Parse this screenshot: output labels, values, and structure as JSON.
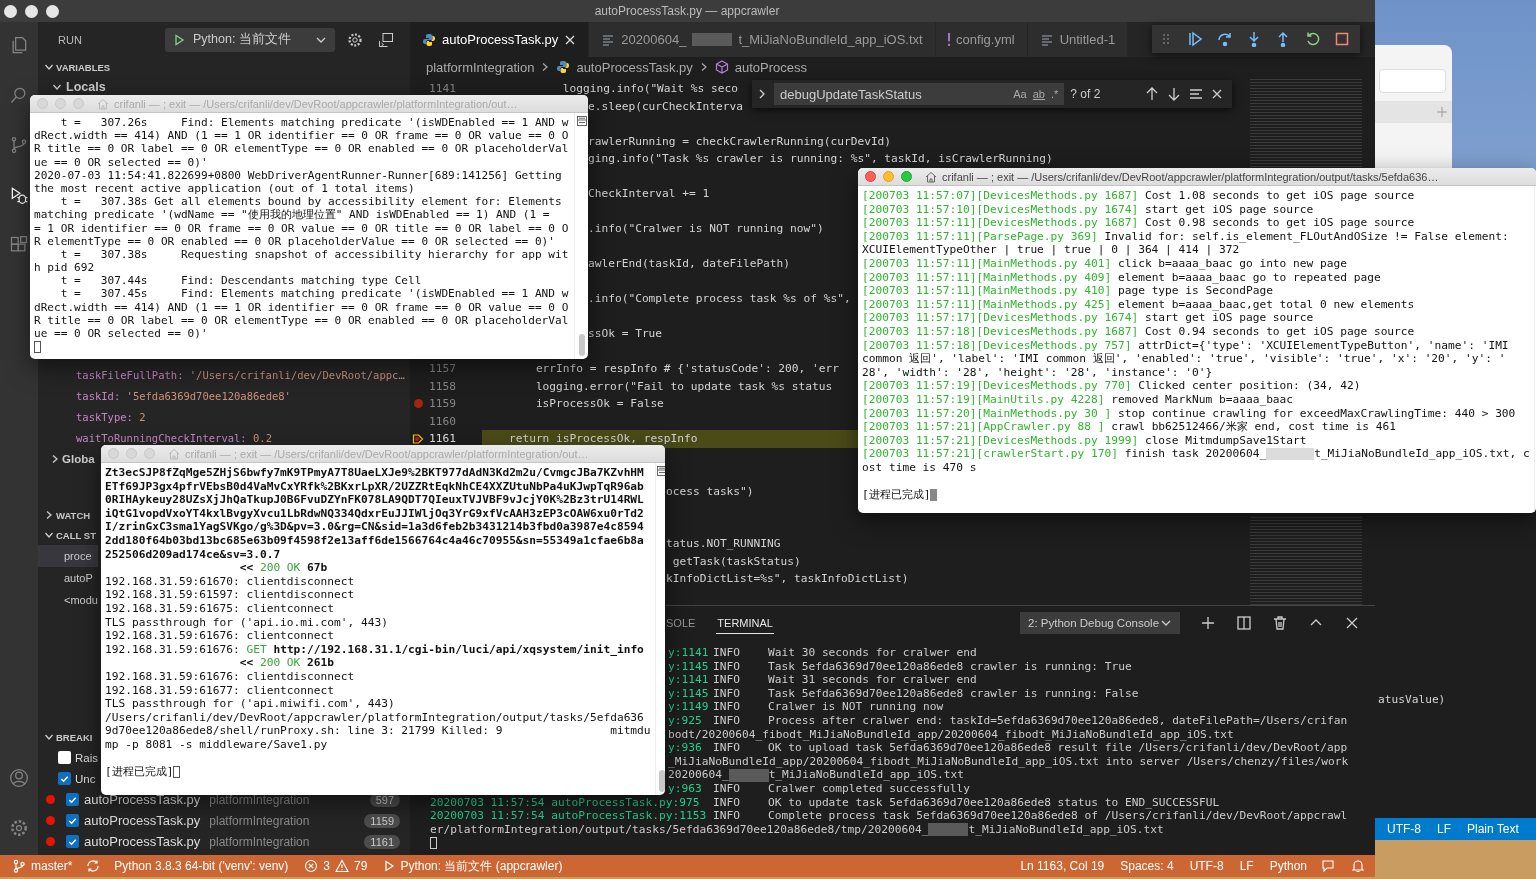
{
  "editor_window": {
    "title": "autoProcessTask.py — appcrawler",
    "activity_bar": [
      {
        "selected": false
      },
      {
        "selected": false
      },
      {
        "selected": false
      },
      {
        "selected": true
      },
      {
        "selected": false
      }
    ],
    "activity_bar_bottom": [
      {
        "selected": false
      },
      {
        "selected": false
      }
    ],
    "sidebar": {
      "title": "RUN",
      "run_config": "Python: 当前文件",
      "variables": {
        "title": "VARIABLES",
        "expanded": true,
        "scope": {
          "label": "Locals",
          "expanded": true
        },
        "items": [
          {
            "name": "taskFileFullPath:",
            "value": "'/Users/crifanli/dev/DevRoot/appc…"
          },
          {
            "name": "taskId:",
            "value": "'5efda6369d70ee120a86ede8'"
          },
          {
            "name": "taskType:",
            "value": "2"
          },
          {
            "name": "waitToRunningCheckInterval:",
            "value": "0.2"
          }
        ],
        "globals": {
          "label": "Globa",
          "expanded": false
        }
      },
      "watch": {
        "title": "WATCH",
        "expanded": false
      },
      "call_stack": {
        "title": "CALL ST",
        "expanded": true,
        "frames": [
          {
            "label": "proce",
            "selected": true
          },
          {
            "label": "autoP",
            "selected": false
          },
          {
            "label": "<modu",
            "selected": false
          }
        ]
      },
      "breakpoints": {
        "title": "BREAKI",
        "expanded": true,
        "exceptions": [
          {
            "label": "Rais",
            "checked": false
          },
          {
            "label": "Unc",
            "checked": true
          }
        ],
        "items": [
          {
            "file": "autoProcessTask.py",
            "folder": "platformIntegration",
            "line": "597",
            "checked": true
          },
          {
            "file": "autoProcessTask.py",
            "folder": "platformIntegration",
            "line": "1159",
            "checked": true
          },
          {
            "file": "autoProcessTask.py",
            "folder": "platformIntegration",
            "line": "1161",
            "checked": true
          }
        ]
      }
    },
    "tabs": [
      {
        "label": "autoProcessTask.py",
        "kind": "python",
        "selected": true
      },
      {
        "label": "20200604_",
        "label_after": "t_MiJiaNoBundleId_app_iOS.txt",
        "kind": "text",
        "selected": false
      },
      {
        "label": "config.yml",
        "kind": "yaml",
        "selected": false
      },
      {
        "label": "Untitled-1",
        "kind": "text",
        "selected": false
      }
    ],
    "breadcrumb": [
      "platformIntegration",
      "autoProcessTask.py",
      "autoProcess"
    ],
    "find": {
      "query": "debugUpdateTaskStatus",
      "match_case": "Aa",
      "whole_word": "ab",
      "regex": ".*",
      "result": "? of 2"
    },
    "editor": {
      "top_line": {
        "number": "1141",
        "code": "            logging.info(\"Wait %s seco"
      },
      "top_fragments": [
        "e.sleep(curCheckInterva",
        "rawlerRunning = checkCrawlerRunning(curDevId)",
        "ging.info(\"Task %s crawler is running: %s\", taskId, isCrawlerRunning)",
        "CheckInterval += 1",
        ".info(\"Cralwer is NOT running now\")",
        "awlerEnd(taskId, dateFilePath)",
        ".info(\"Complete process task %s of %s\",",
        "ssOk = True"
      ],
      "lines": [
        {
          "number": "1157",
          "code": "        errInfo = respInfo # {'statusCode': 200, 'err",
          "breakpoint": false,
          "current": false
        },
        {
          "number": "1158",
          "code": "        logging.error(\"Fail to update task %s status",
          "breakpoint": false,
          "current": false
        },
        {
          "number": "1159",
          "code": "        isProcessOk = False",
          "breakpoint": true,
          "current": false
        },
        {
          "number": "1160",
          "breakpoint": false,
          "current": false
        },
        {
          "number": "1161",
          "code": "    return isProcessOk, respInfo",
          "breakpoint": false,
          "current": true
        }
      ],
      "lower_fragments": [
        "ocess tasks\")",
        "tatus.NOT_RUNNING",
        " getTask(taskStatus)",
        "kInfoDictList=%s\", taskInfoDictList)"
      ]
    },
    "panel": {
      "tabs": [
        {
          "label": "SOLE",
          "selected": false
        },
        {
          "label": "TERMINAL",
          "selected": true
        }
      ],
      "terminal_picker": "2: Python Debug Console",
      "beside_lines": [
        {
          "src": "y:1141",
          "level": "INFO",
          "msg": "Wait 30 seconds for cralwer end"
        },
        {
          "src": "y:1145",
          "level": "INFO",
          "msg": "Task 5efda6369d70ee120a86ede8 crawler is running: True"
        },
        {
          "src": "y:1141",
          "level": "INFO",
          "msg": "Wait 31 seconds for cralwer end"
        },
        {
          "src": "y:1145",
          "level": "INFO",
          "msg": "Task 5efda6369d70ee120a86ede8 crawler is running: False"
        },
        {
          "src": "y:1149",
          "level": "INFO",
          "msg": "Cralwer is NOT running now"
        },
        {
          "src": "y:925",
          "level": "INFO",
          "msg": "Process after cralwer end: taskId=5efda6369d70ee120a86ede8, dateFilePath=/Users/crifan"
        },
        {
          "msg": "bodt/20200604_fibodt_MiJiaNoBundleId_app/20200604_fibodt_MiJiaNoBundleId_app_iOS.txt"
        },
        {
          "src": "y:936",
          "level": "INFO",
          "msg": "OK to upload task 5efda6369d70ee120a86ede8 result file /Users/crifanli/dev/DevRoot/app"
        },
        {
          "msg": "_MiJiaNoBundleId_app/20200604_fibodt_MiJiaNoBundleId_app_iOS.txt into server /Users/chenzy/files/work"
        },
        {
          "msg": "20200604_",
          "msg_after": "t_MiJiaNoBundleId_app_iOS.txt"
        },
        {
          "src": "y:963",
          "level": "INFO",
          "msg": "Cralwer completed successfully"
        }
      ],
      "lines": [
        {
          "src": "20200703 11:57:54 autoProcessTask.py:975",
          "level": "INFO",
          "msg": "OK to update task 5efda6369d70ee120a86ede8 status to END_SUCCESSFUL"
        },
        {
          "src": "20200703 11:57:54 autoProcessTask.py:1153",
          "level": "INFO",
          "msg": "Complete process task 5efda6369d70ee120a86ede8 of /Users/crifanli/dev/DevRoot/appcrawl"
        },
        {
          "msg": "er/platformIntegration/output/tasks/5efda6369d70ee120a86ede8/tmp/20200604_",
          "msg_after": "t_MiJiaNoBundleId_app_iOS.txt"
        }
      ]
    },
    "status_bar": {
      "branch": "master*",
      "interpreter": "Python 3.8.3 64-bit ('venv': venv)",
      "errors": "3",
      "warnings": "79",
      "launch": "Python: 当前文件 (appcrawler)",
      "position": "Ln 1163, Col 19",
      "indent": "Spaces: 4",
      "encoding": "UTF-8",
      "eol": "LF",
      "language": "Python"
    }
  },
  "background_window": {
    "code": "atusValue)",
    "status_items": [
      "UTF-8",
      "LF",
      "Plain Text"
    ]
  },
  "terminals": [
    {
      "title": "crifanli — ; exit — /Users/crifanli/dev/DevRoot/appcrawler/platformIntegration/out…",
      "active": false,
      "lines": [
        {
          "kind": "output",
          "text": "    t =   307.26s     Find: Elements matching predicate '(isWDEnabled == 1 AND w"
        },
        {
          "kind": "output",
          "text": "dRect.width == 414) AND (1 == 1 OR identifier == 0 OR frame == 0 OR value == 0 O"
        },
        {
          "kind": "output",
          "text": "R title == 0 OR label == 0 OR elementType == 0 OR enabled == 0 OR placeholderVal"
        },
        {
          "kind": "output",
          "text": "ue == 0 OR selected == 0)'"
        },
        {
          "kind": "output",
          "text": "2020-07-03 11:54:41.822699+0800 WebDriverAgentRunner-Runner[689:141256] Getting"
        },
        {
          "kind": "output",
          "text": "the most recent active application (out of 1 total items)"
        },
        {
          "kind": "output",
          "text": "    t =   307.38s Get all elements bound by accessibility element for: Elements"
        },
        {
          "kind": "output",
          "text": "matching predicate '(wdName == \"使用我的地理位置\" AND isWDEnabled == 1) AND (1 ="
        },
        {
          "kind": "output",
          "text": "= 1 OR identifier == 0 OR frame == 0 OR value == 0 OR title == 0 OR label == 0 O"
        },
        {
          "kind": "output",
          "text": "R elementType == 0 OR enabled == 0 OR placeholderValue == 0 OR selected == 0)'"
        },
        {
          "kind": "output",
          "text": "    t =   307.38s     Requesting snapshot of accessibility hierarchy for app wit"
        },
        {
          "kind": "output",
          "text": "h pid 692"
        },
        {
          "kind": "output",
          "text": "    t =   307.44s     Find: Descendants matching type Cell"
        },
        {
          "kind": "output",
          "text": "    t =   307.45s     Find: Elements matching predicate '(isWDEnabled == 1 AND w"
        },
        {
          "kind": "output",
          "text": "dRect.width == 414) AND (1 == 1 OR identifier == 0 OR frame == 0 OR value == 0 O"
        },
        {
          "kind": "output",
          "text": "R title == 0 OR label == 0 OR elementType == 0 OR enabled == 0 OR placeholderVal"
        },
        {
          "kind": "output",
          "text": "ue == 0 OR selected == 0)'"
        },
        {
          "kind": "prompt"
        }
      ]
    },
    {
      "title": "crifanli — ; exit — /Users/crifanli/dev/DevRoot/appcrawler/platformIntegration/out…",
      "active": false,
      "lines": [
        {
          "kind": "output",
          "segments": [
            {
              "kind": "bold",
              "text": "Zt3ecSJP8fZqMge5ZHjS6bwfy7mK9TPmyA7T8UaeLXJe9%2BKT977dAdN3Kd2m2u/CvmgcJBa7KZvhHM"
            }
          ]
        },
        {
          "kind": "output",
          "segments": [
            {
              "kind": "bold",
              "text": "ETf69JP3gx4pfrVEbsB0d4VaMvCxYRfk%2BKxrLpXR/2UZZRtEqkNhCE4XXZUtuNbPa4uKJwpTqR96ab"
            }
          ]
        },
        {
          "kind": "output",
          "segments": [
            {
              "kind": "bold",
              "text": "0RIHAykeuy28UZsXjJhQaTkupJ0B6FvuDZYnFK078LA9QDT7QIeuxTVJVBF9vJcjY0K%2Bz3trU14RWL"
            }
          ]
        },
        {
          "kind": "output",
          "segments": [
            {
              "kind": "bold",
              "text": "iQtG1vopdVxoYT4kxlBvgyXvcu1LbRdwNQ334QdxrEuJJIWljOq3YrG9xfVcAAH3zEP3cOAW6xu0rTd2"
            }
          ]
        },
        {
          "kind": "output",
          "segments": [
            {
              "kind": "bold",
              "text": "I/zrinGxC3sma1YagSVKgo/g%3D&pv=3.0&rg=CN&sid=1a3d6feb2b3431214b3fbd0a3987e4c8594"
            }
          ]
        },
        {
          "kind": "output",
          "segments": [
            {
              "kind": "bold",
              "text": "2dd180f64b03bd13bc685e63b09f4598f2e13aff6de1566764c4a46c70955&sn=55349a1cfae6b8a"
            }
          ]
        },
        {
          "kind": "output",
          "segments": [
            {
              "kind": "bold",
              "text": "252506d209ad174ce&sv=3.0.7"
            }
          ]
        },
        {
          "kind": "output",
          "segments": [
            {
              "kind": "bold",
              "text": "                    << "
            },
            {
              "kind": "green",
              "text": "200 OK"
            },
            {
              "kind": "bold",
              "text": " 67b"
            }
          ]
        },
        {
          "kind": "output",
          "text": "192.168.31.59:61670: clientdisconnect"
        },
        {
          "kind": "output",
          "text": "192.168.31.59:61597: clientdisconnect"
        },
        {
          "kind": "output",
          "text": "192.168.31.59:61675: clientconnect"
        },
        {
          "kind": "output",
          "text": "TLS passthrough for ('api.io.mi.com', 443)"
        },
        {
          "kind": "output",
          "text": "192.168.31.59:61676: clientconnect"
        },
        {
          "kind": "output",
          "segments": [
            {
              "kind": "plain",
              "text": "192.168.31.59:61676: "
            },
            {
              "kind": "green",
              "text": "GET"
            },
            {
              "kind": "bold",
              "text": " http://192.168.31.1/cgi-bin/luci/api/xqsystem/init_info"
            }
          ]
        },
        {
          "kind": "output",
          "segments": [
            {
              "kind": "bold",
              "text": "                    << "
            },
            {
              "kind": "green",
              "text": "200 OK"
            },
            {
              "kind": "bold",
              "text": " 261b"
            }
          ]
        },
        {
          "kind": "output",
          "text": "192.168.31.59:61676: clientdisconnect"
        },
        {
          "kind": "output",
          "text": "192.168.31.59:61677: clientconnect"
        },
        {
          "kind": "output",
          "text": "TLS passthrough for ('api.miwifi.com', 443)"
        },
        {
          "kind": "output",
          "text": "/Users/crifanli/dev/DevRoot/appcrawler/platformIntegration/output/tasks/5efda636"
        },
        {
          "kind": "output",
          "text": "9d70ee120a86ede8/shell/runProxy.sh: line 3: 21799 Killed: 9                mitmdu"
        },
        {
          "kind": "output",
          "text": "mp -p 8081 -s middleware/Save1.py"
        },
        {
          "kind": "status",
          "text": "[进程已完成]"
        }
      ]
    },
    {
      "title": "crifanli — ; exit — /Users/crifanli/dev/DevRoot/appcrawler/platformIntegration/output/tasks/5efda636…",
      "active": true,
      "lines": [
        {
          "kind": "output",
          "segments": [
            {
              "kind": "green",
              "text": "[200703 11:57:07][DevicesMethods.py 1687]"
            },
            {
              "kind": "plain",
              "text": " Cost 1.08 seconds to get iOS page source"
            }
          ]
        },
        {
          "kind": "output",
          "segments": [
            {
              "kind": "green",
              "text": "[200703 11:57:10][DevicesMethods.py 1674]"
            },
            {
              "kind": "plain",
              "text": " start get iOS page source"
            }
          ]
        },
        {
          "kind": "output",
          "segments": [
            {
              "kind": "green",
              "text": "[200703 11:57:11][DevicesMethods.py 1687]"
            },
            {
              "kind": "plain",
              "text": " Cost 0.98 seconds to get iOS page source"
            }
          ]
        },
        {
          "kind": "output",
          "segments": [
            {
              "kind": "green",
              "text": "[200703 11:57:11][ParsePage.py 369]"
            },
            {
              "kind": "plain",
              "text": " Invalid for: self.is_element_FLOutAndOSize != False element:"
            }
          ]
        },
        {
          "kind": "output",
          "text": "XCUIElementTypeOther | true | true | 0 | 364 | 414 | 372"
        },
        {
          "kind": "output",
          "segments": [
            {
              "kind": "green",
              "text": "[200703 11:57:11][MainMethods.py 401]"
            },
            {
              "kind": "plain",
              "text": " click b=aaaa_baac go into new page"
            }
          ]
        },
        {
          "kind": "output",
          "segments": [
            {
              "kind": "green",
              "text": "[200703 11:57:11][MainMethods.py 409]"
            },
            {
              "kind": "plain",
              "text": " element b=aaaa_baac go to repeated page"
            }
          ]
        },
        {
          "kind": "output",
          "segments": [
            {
              "kind": "green",
              "text": "[200703 11:57:11][MainMethods.py 410]"
            },
            {
              "kind": "plain",
              "text": " page type is SecondPage"
            }
          ]
        },
        {
          "kind": "output",
          "segments": [
            {
              "kind": "green",
              "text": "[200703 11:57:11][MainMethods.py 425]"
            },
            {
              "kind": "plain",
              "text": " element b=aaaa_baac,get total 0 new elements"
            }
          ]
        },
        {
          "kind": "output",
          "segments": [
            {
              "kind": "green",
              "text": "[200703 11:57:17][DevicesMethods.py 1674]"
            },
            {
              "kind": "plain",
              "text": " start get iOS page source"
            }
          ]
        },
        {
          "kind": "output",
          "segments": [
            {
              "kind": "green",
              "text": "[200703 11:57:18][DevicesMethods.py 1687]"
            },
            {
              "kind": "plain",
              "text": " Cost 0.94 seconds to get iOS page source"
            }
          ]
        },
        {
          "kind": "output",
          "segments": [
            {
              "kind": "green",
              "text": "[200703 11:57:18][DevicesMethods.py 757]"
            },
            {
              "kind": "plain",
              "text": " attrDict={'type': 'XCUIElementTypeButton', 'name': 'IMI"
            }
          ]
        },
        {
          "kind": "output",
          "text": "common 返回', 'label': 'IMI common 返回', 'enabled': 'true', 'visible': 'true', 'x': '20', 'y': '"
        },
        {
          "kind": "output",
          "text": "28', 'width': '28', 'height': '28', 'instance': '0'}"
        },
        {
          "kind": "output",
          "segments": [
            {
              "kind": "green",
              "text": "[200703 11:57:19][DevicesMethods.py 770]"
            },
            {
              "kind": "plain",
              "text": " Clicked center position: (34, 42)"
            }
          ]
        },
        {
          "kind": "output",
          "segments": [
            {
              "kind": "green",
              "text": "[200703 11:57:19][MainUtils.py 4228]"
            },
            {
              "kind": "plain",
              "text": " removed MarkNum b=aaaa_baac"
            }
          ]
        },
        {
          "kind": "output",
          "segments": [
            {
              "kind": "green",
              "text": "[200703 11:57:20][MainMethods.py 30 ]"
            },
            {
              "kind": "plain",
              "text": " stop continue crawling for exceedMaxCrawlingTime: 440 > 300"
            }
          ]
        },
        {
          "kind": "output",
          "segments": [
            {
              "kind": "green",
              "text": "[200703 11:57:21][AppCrawler.py 88 ]"
            },
            {
              "kind": "plain",
              "text": " crawl bb62512466/米家 end, cost time is 461"
            }
          ]
        },
        {
          "kind": "output",
          "segments": [
            {
              "kind": "green",
              "text": "[200703 11:57:21][DevicesMethods.py 1999]"
            },
            {
              "kind": "plain",
              "text": " close MitmdumpSave1Start"
            }
          ]
        },
        {
          "kind": "output",
          "segments": [
            {
              "kind": "green",
              "text": "[200703 11:57:21][crawlerStart.py 170]"
            },
            {
              "kind": "plain",
              "text": " finish task 20200604_"
            },
            {
              "kind": "redacted"
            },
            {
              "kind": "plain",
              "text": "t_MiJiaNoBundleId_app_iOS.txt, c"
            }
          ]
        },
        {
          "kind": "output",
          "text": "ost time is 470 s"
        },
        {
          "kind": "status",
          "text": "[进程已完成]"
        }
      ]
    }
  ]
}
